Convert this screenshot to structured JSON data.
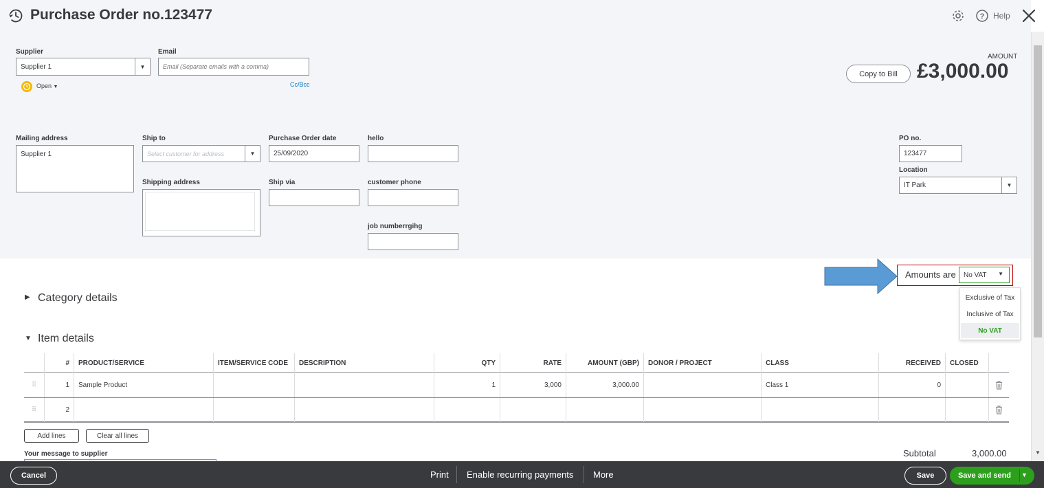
{
  "header": {
    "title": "Purchase Order no.123477",
    "help_label": "Help"
  },
  "supplier": {
    "label": "Supplier",
    "value": "Supplier 1",
    "status": "Open"
  },
  "email": {
    "label": "Email",
    "placeholder": "Email (Separate emails with a comma)",
    "cc_bcc": "Cc/Bcc"
  },
  "amount": {
    "label": "AMOUNT",
    "value": "£3,000.00",
    "copy_to_bill": "Copy to Bill"
  },
  "mailing_address": {
    "label": "Mailing address",
    "value": "Supplier 1"
  },
  "ship_to": {
    "label": "Ship to",
    "placeholder": "Select customer for address"
  },
  "shipping_address": {
    "label": "Shipping address",
    "value": ""
  },
  "po_date": {
    "label": "Purchase Order date",
    "value": "25/09/2020"
  },
  "ship_via": {
    "label": "Ship via",
    "value": ""
  },
  "custom_fields": {
    "hello": {
      "label": "hello",
      "value": ""
    },
    "customer_phone": {
      "label": "customer phone",
      "value": ""
    },
    "job_number": {
      "label": "job numberrgihg",
      "value": ""
    }
  },
  "po_no": {
    "label": "PO no.",
    "value": "123477"
  },
  "location": {
    "label": "Location",
    "value": "IT Park"
  },
  "amounts_are": {
    "label": "Amounts are",
    "selected": "No VAT",
    "options": [
      "Exclusive of Tax",
      "Inclusive of Tax",
      "No VAT"
    ]
  },
  "sections": {
    "category": "Category details",
    "item": "Item details"
  },
  "table": {
    "headers": [
      "#",
      "PRODUCT/SERVICE",
      "ITEM/SERVICE CODE",
      "DESCRIPTION",
      "QTY",
      "RATE",
      "AMOUNT (GBP)",
      "DONOR / PROJECT",
      "CLASS",
      "RECEIVED",
      "CLOSED"
    ],
    "rows": [
      {
        "num": "1",
        "product": "Sample Product",
        "code": "",
        "description": "",
        "qty": "1",
        "rate": "3,000",
        "amount": "3,000.00",
        "donor": "",
        "class": "Class 1",
        "received": "0"
      },
      {
        "num": "2",
        "product": "",
        "code": "",
        "description": "",
        "qty": "",
        "rate": "",
        "amount": "",
        "donor": "",
        "class": "",
        "received": ""
      }
    ]
  },
  "table_actions": {
    "add_lines": "Add lines",
    "clear_all_lines": "Clear all lines"
  },
  "message": {
    "label": "Your message to supplier"
  },
  "subtotal": {
    "label": "Subtotal",
    "value": "3,000.00"
  },
  "footer": {
    "cancel": "Cancel",
    "print": "Print",
    "recurring": "Enable recurring payments",
    "more": "More",
    "save": "Save",
    "save_and_send": "Save and send"
  },
  "colors": {
    "green": "#2ca01c",
    "dark": "#393a3d",
    "link": "#0077c5",
    "status_yellow": "#f5b800",
    "arrow_blue": "#5b9bd5",
    "highlight_red": "#c00000"
  }
}
